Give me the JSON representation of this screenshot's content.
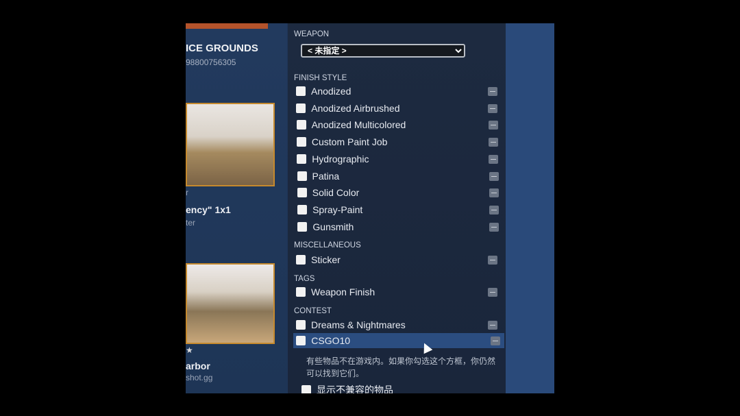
{
  "left": {
    "title": "ICE GROUNDS",
    "subtitle": "98800756305",
    "items": [
      {
        "line0": "r",
        "name": "ency\" 1x1",
        "sub": "ter"
      },
      {
        "name": "arbor",
        "sub": "shot.gg"
      }
    ]
  },
  "filters": {
    "weapon_label": "WEAPON",
    "weapon_selected": "< 未指定 >",
    "finish_label": "FINISH STYLE",
    "finish": [
      "Anodized",
      "Anodized Airbrushed",
      "Anodized Multicolored",
      "Custom Paint Job",
      "Hydrographic",
      "Patina",
      "Solid Color",
      "Spray-Paint",
      "Gunsmith"
    ],
    "misc_label": "MISCELLANEOUS",
    "misc": [
      "Sticker"
    ],
    "tags_label": "TAGS",
    "tags": [
      "Weapon Finish"
    ],
    "contest_label": "CONTEST",
    "contest": [
      "Dreams & Nightmares",
      "CSGO10"
    ],
    "note": "有些物品不在游戏内。如果你勾选这个方框，你仍然可以找到它们。",
    "show_incompatible": "显示不兼容的物品"
  }
}
